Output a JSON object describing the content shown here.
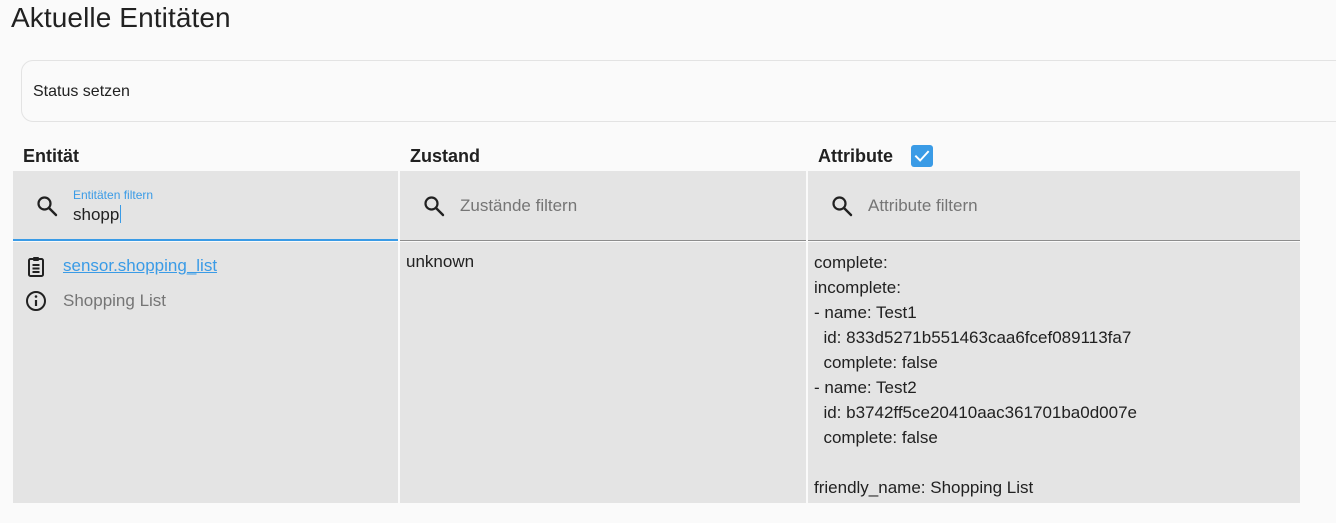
{
  "page": {
    "title": "Aktuelle Entitäten"
  },
  "set_state": {
    "label": "Status setzen"
  },
  "columns": {
    "entity": "Entität",
    "state": "Zustand",
    "attributes": "Attribute",
    "attributes_checked": true
  },
  "filters": {
    "entity": {
      "label": "Entitäten filtern",
      "value": "shopp"
    },
    "state": {
      "placeholder": "Zustände filtern"
    },
    "attributes": {
      "placeholder": "Attribute filtern"
    }
  },
  "row": {
    "entity_id": "sensor.shopping_list",
    "friendly_name": "Shopping List",
    "state": "unknown",
    "attributes": "complete: \nincomplete: \n- name: Test1\n  id: 833d5271b551463caa6fcef089113fa7\n  complete: false\n- name: Test2\n  id: b3742ff5ce20410aac361701ba0d007e\n  complete: false\n\nfriendly_name: Shopping List"
  },
  "colors": {
    "accent": "#3a9be6",
    "cell_background": "#e4e4e4",
    "page_background": "#fafafa"
  }
}
